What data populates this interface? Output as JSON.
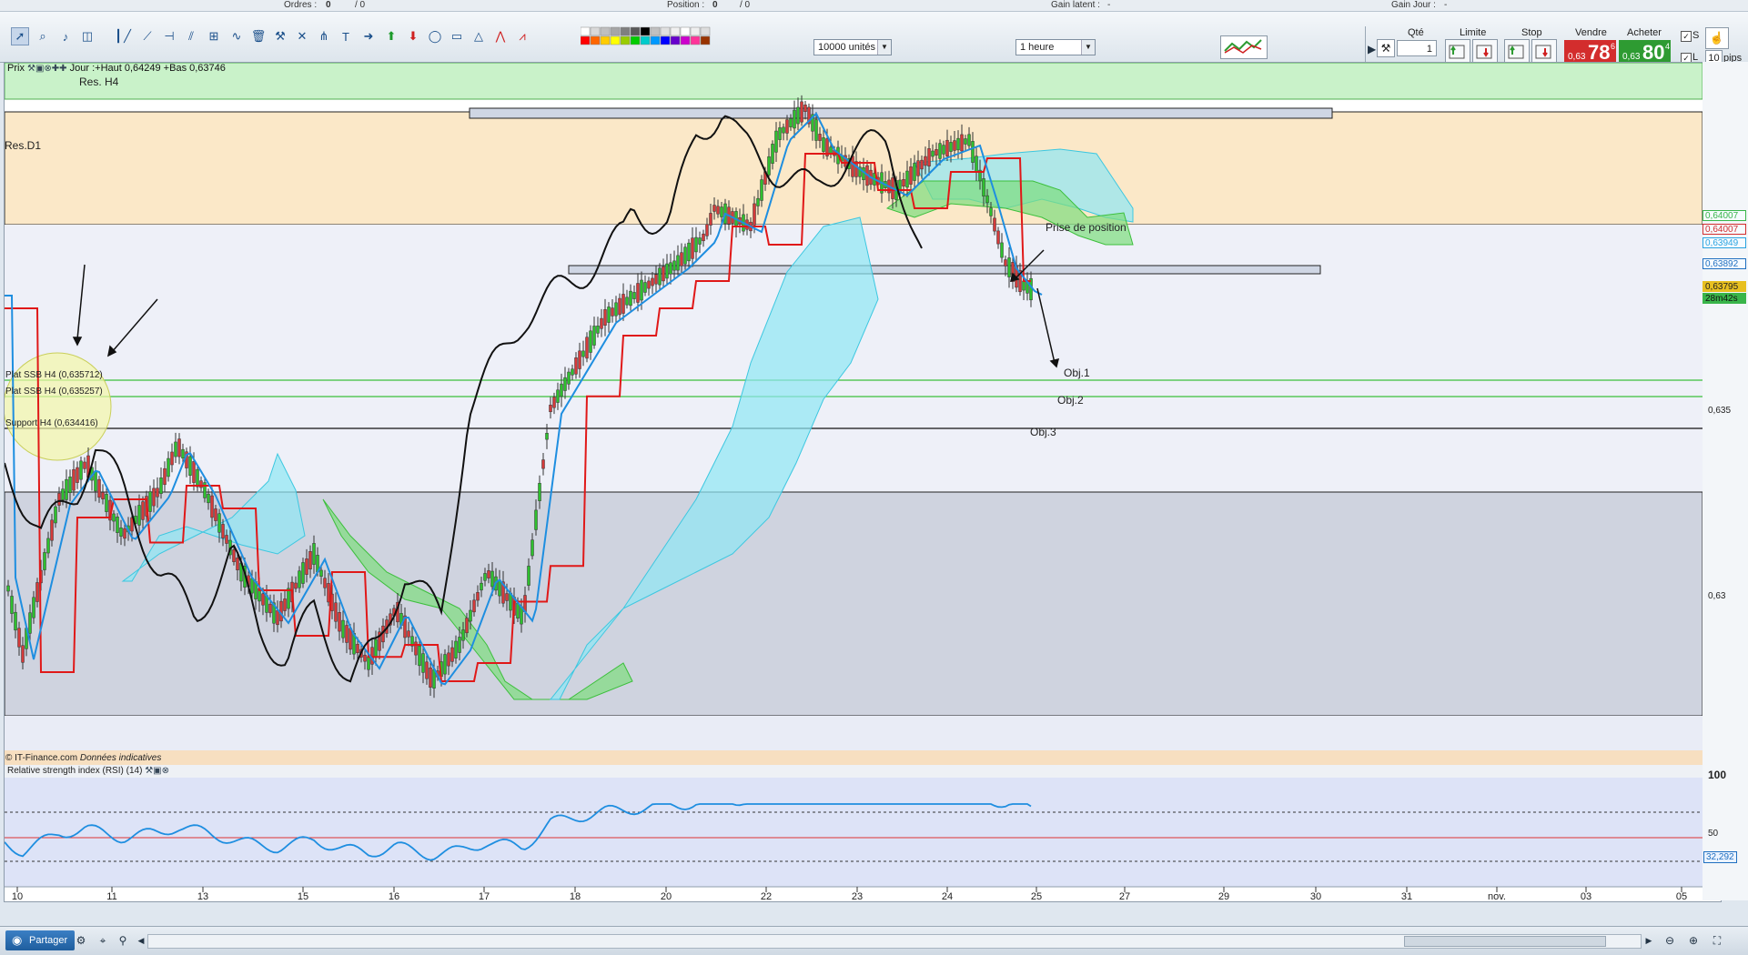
{
  "top": {
    "orders_label": "Ordres :",
    "orders_value": "0",
    "orders_sep": "/ 0",
    "position_label": "Position :",
    "position_value": "0",
    "position_sep": "/ 0",
    "gain_latent_label": "Gain latent :",
    "gain_latent_value": "-",
    "gain_jour_label": "Gain Jour :",
    "gain_jour_value": "-"
  },
  "toolbar": {
    "units_value": "10000 unités",
    "timeframe_value": "1 heure",
    "qty_label": "Qté",
    "qty_value": "1",
    "limit_label": "Limite",
    "stop_label": "Stop",
    "sell_label": "Vendre",
    "buy_label": "Acheter",
    "sell_small": "0,63",
    "sell_big": "78",
    "sell_sup": "6",
    "buy_small": "0,63",
    "buy_big": "80",
    "buy_sup": "4",
    "s_label": "S",
    "l_label": "L",
    "pips_value": "10",
    "pips_label": "pips",
    "colors": {
      "sell": "#d32d2d",
      "buy": "#2e9b32"
    }
  },
  "chart": {
    "price_label": "Prix",
    "ohlc_info": "Jour :+Haut 0,64249 +Bas 0,63746",
    "watermark": "© IT-Finance.com",
    "watermark_note": "Données indicatives",
    "annotations": {
      "res_h4": "Res. H4",
      "res_d1": "Res.D1",
      "prise": "Prise de position",
      "obj1": "Obj.1",
      "obj2": "Obj.2",
      "obj3": "Obj.3",
      "plat1": "Plat SSB H4 (0,635712)",
      "plat2": "Plat SSB H4 (0,635257)",
      "support": "Support H4 (0,634416)"
    },
    "price_tags": [
      {
        "value": "0,64007",
        "color": "#39b54a",
        "y": 0.64007
      },
      {
        "value": "0,64007",
        "color": "#d32d2d",
        "y": 0.64007
      },
      {
        "value": "0,63949",
        "color": "#29a3e0",
        "y": 0.63949
      },
      {
        "value": "0,63892",
        "color": "#1f6fc0",
        "y": 0.63892
      },
      {
        "value": "0,63795",
        "color": "#e8c020",
        "y": 0.63795
      },
      {
        "value": "28m42s",
        "color": "#39b54a",
        "y": 0.63795
      }
    ],
    "y_ticks": [
      "0,635",
      "0,63"
    ],
    "x_ticks": [
      "10",
      "11",
      "13",
      "15",
      "16",
      "17",
      "18",
      "20",
      "22",
      "23",
      "24",
      "25",
      "27",
      "29",
      "30",
      "31",
      "nov.",
      "03",
      "05"
    ]
  },
  "rsi": {
    "title": "Relative strength index (RSI) (14)",
    "y_ticks": [
      "100",
      "50"
    ],
    "last_value": "32,292"
  },
  "bottom": {
    "share_label": "Partager"
  }
}
